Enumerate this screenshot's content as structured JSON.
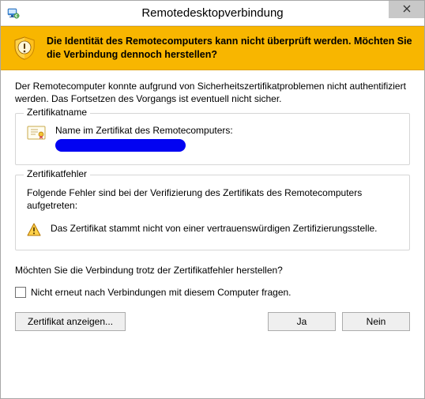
{
  "window": {
    "title": "Remotedesktopverbindung"
  },
  "banner": {
    "text": "Die Identität des Remotecomputers kann nicht überprüft werden. Möchten Sie die Verbindung dennoch herstellen?"
  },
  "intro": "Der Remotecomputer konnte aufgrund von Sicherheitszertifikatproblemen nicht authentifiziert werden. Das Fortsetzen des Vorgangs ist eventuell nicht sicher.",
  "cert_group": {
    "legend": "Zertifikatname",
    "label": "Name im Zertifikat des Remotecomputers:",
    "value_redacted": true
  },
  "err_group": {
    "legend": "Zertifikatfehler",
    "desc": "Folgende Fehler sind bei der Verifizierung des Zertifikats des Remotecomputers aufgetreten:",
    "item": "Das Zertifikat stammt nicht von einer vertrauenswürdigen Zertifizierungsstelle."
  },
  "question": "Möchten Sie die Verbindung trotz der Zertifikatfehler herstellen?",
  "checkbox": {
    "checked": false,
    "label": "Nicht erneut nach Verbindungen mit diesem Computer fragen."
  },
  "buttons": {
    "view_cert": "Zertifikat anzeigen...",
    "yes": "Ja",
    "no": "Nein"
  }
}
